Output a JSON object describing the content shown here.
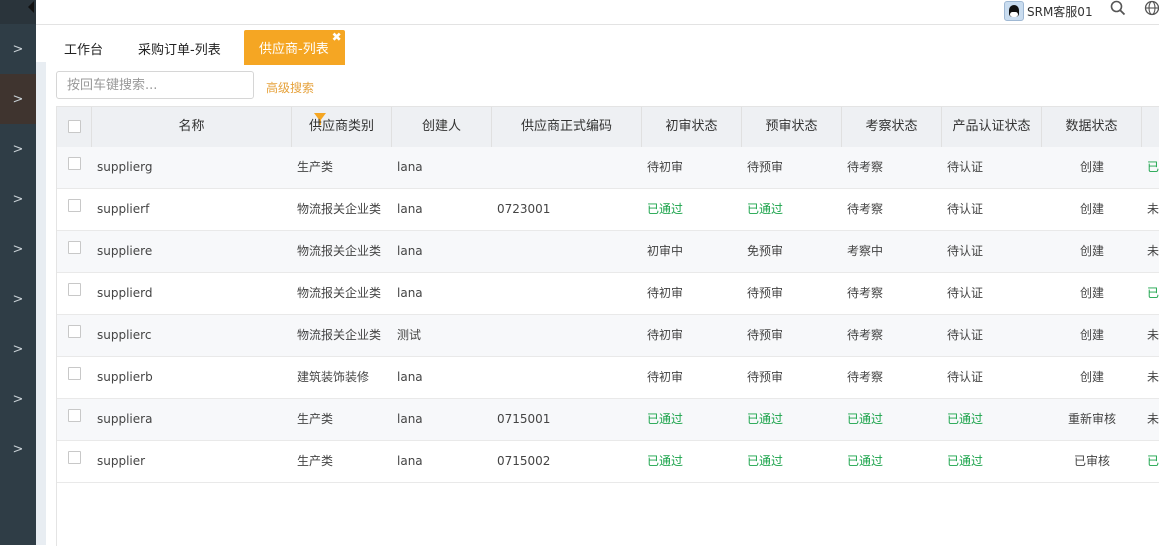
{
  "topbar": {
    "username": "SRM客服01",
    "icons": [
      "qq-icon",
      "search-icon",
      "globe-icon"
    ]
  },
  "sidebar": {
    "item_icon": "chevron-right-icon",
    "items": [
      ">",
      ">",
      ">",
      ">",
      ">",
      ">",
      ">",
      ">",
      ">"
    ]
  },
  "tabs": [
    {
      "label": "工作台"
    },
    {
      "label": "采购订单-列表"
    },
    {
      "label": "供应商-列表",
      "active": true,
      "close": "✖"
    }
  ],
  "search": {
    "placeholder": "按回车键搜索...",
    "advanced_label": "高级搜索"
  },
  "table": {
    "headers": [
      "名称",
      "供应商类别",
      "创建人",
      "供应商正式编码",
      "初审状态",
      "预审状态",
      "考察状态",
      "产品认证状态",
      "数据状态"
    ],
    "rows": [
      [
        "supplierg",
        "生产类",
        "lana",
        "",
        "待初审",
        "待预审",
        "待考察",
        "待认证",
        "创建",
        "已"
      ],
      [
        "supplierf",
        "物流报关企业类",
        "lana",
        "0723001",
        "已通过",
        "已通过",
        "待考察",
        "待认证",
        "创建",
        "未"
      ],
      [
        "suppliere",
        "物流报关企业类",
        "lana",
        "",
        "初审中",
        "免预审",
        "考察中",
        "待认证",
        "创建",
        "未"
      ],
      [
        "supplierd",
        "物流报关企业类",
        "lana",
        "",
        "待初审",
        "待预审",
        "待考察",
        "待认证",
        "创建",
        "已"
      ],
      [
        "supplierc",
        "物流报关企业类",
        "测试",
        "",
        "待初审",
        "待预审",
        "待考察",
        "待认证",
        "创建",
        "未"
      ],
      [
        "supplierb",
        "建筑装饰装修",
        "lana",
        "",
        "待初审",
        "待预审",
        "待考察",
        "待认证",
        "创建",
        "未"
      ],
      [
        "suppliera",
        "生产类",
        "lana",
        "0715001",
        "已通过",
        "已通过",
        "已通过",
        "已通过",
        "重新审核",
        "未"
      ],
      [
        "supplier",
        "生产类",
        "lana",
        "0715002",
        "已通过",
        "已通过",
        "已通过",
        "已通过",
        "已审核",
        "已"
      ]
    ]
  },
  "colors": {
    "accent": "#f5a623",
    "sidebar": "#2f3d46",
    "success": "#1aa34a",
    "header_bg": "#eef0f3"
  }
}
